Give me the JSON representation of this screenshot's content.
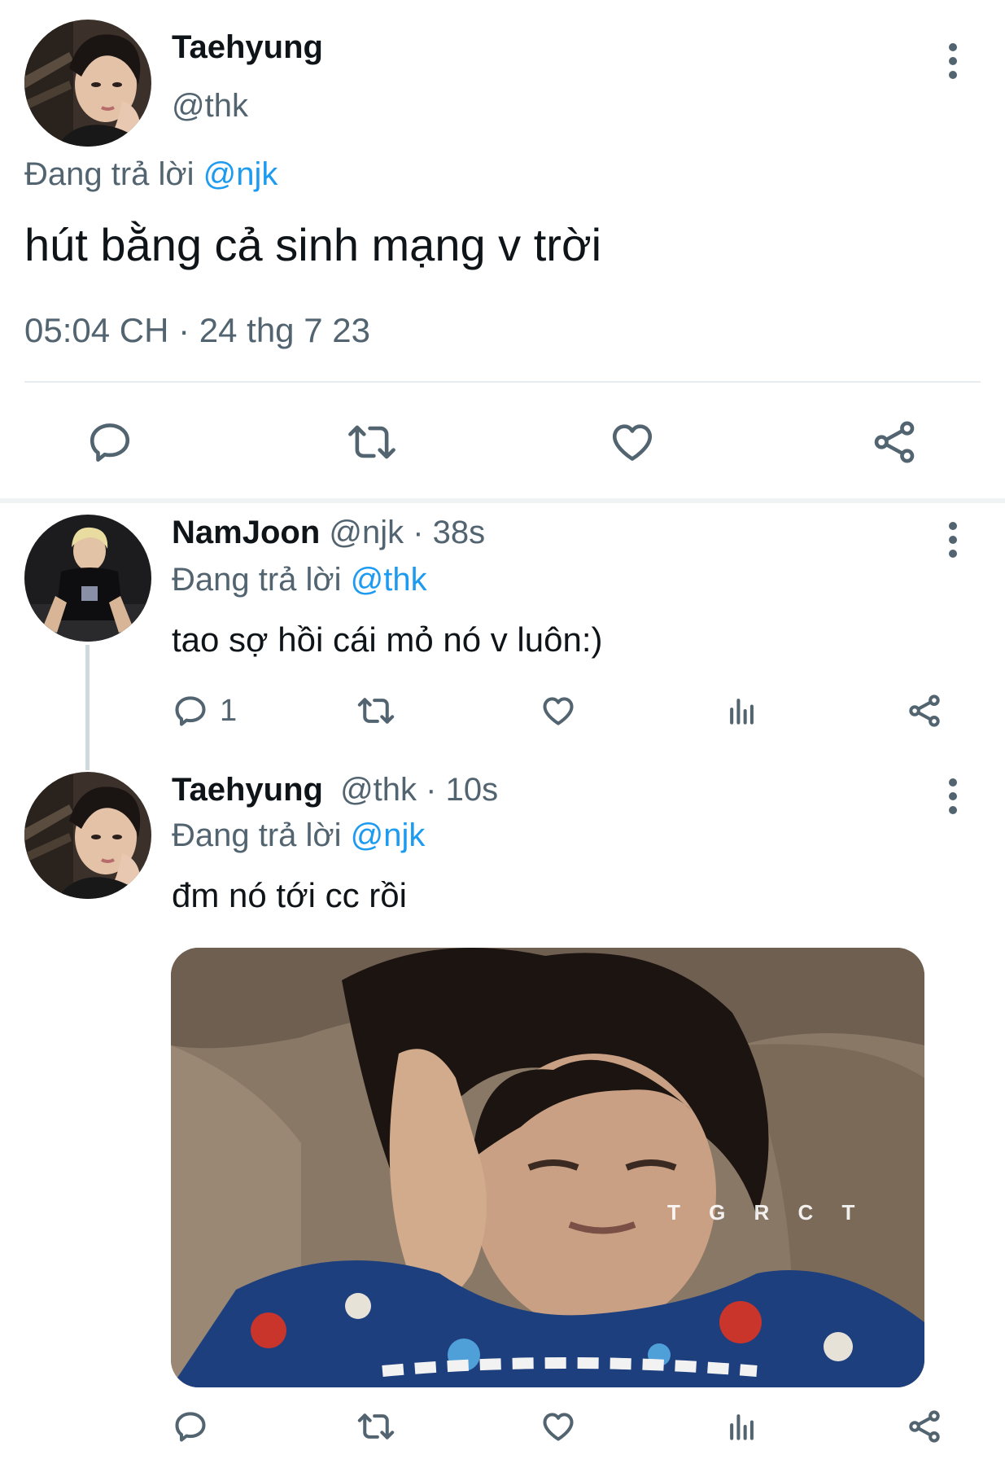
{
  "main_tweet": {
    "display_name": "Taehyung",
    "handle": "@thk",
    "replying_prefix": "Đang trả lời",
    "replying_to": "@njk",
    "text": "hút bằng cả sinh mạng v trời",
    "timestamp": "05:04 CH · 24 thg 7 23",
    "avatar_icon": "avatar-taehyung",
    "actions": [
      "reply-icon",
      "retweet-icon",
      "like-icon",
      "share-icon"
    ]
  },
  "reply_1": {
    "display_name": "NamJoon",
    "handle": "@njk",
    "time": "· 38s",
    "replying_prefix": "Đang trả lời",
    "replying_to": "@thk",
    "text": "tao sợ hồi cái mỏ nó v luôn:)",
    "reply_count": "1",
    "avatar_icon": "avatar-namjoon",
    "actions": [
      "reply-icon",
      "retweet-icon",
      "like-icon",
      "views-icon",
      "share-icon"
    ]
  },
  "reply_2": {
    "display_name": "Taehyung",
    "handle": "@thk",
    "time": "· 10s",
    "replying_prefix": "Đang trả lời",
    "replying_to": "@njk",
    "text": "đm nó tới cc rồi",
    "media_watermark": "T G R C T",
    "avatar_icon": "avatar-taehyung",
    "actions": [
      "reply-icon",
      "retweet-icon",
      "like-icon",
      "views-icon",
      "share-icon"
    ]
  },
  "colors": {
    "accent": "#1d9bf0",
    "text": "#0f1419",
    "muted": "#536471"
  }
}
